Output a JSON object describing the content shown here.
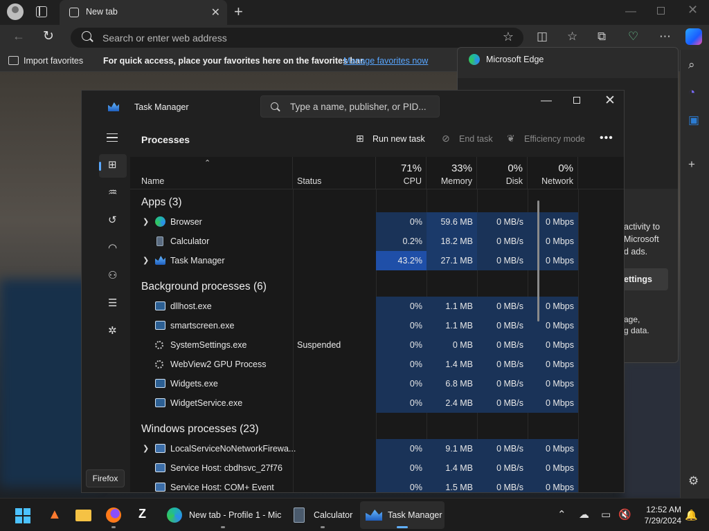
{
  "browser": {
    "tab_title": "New tab",
    "address_placeholder": "Search or enter web address",
    "favbar": {
      "import_label": "Import favorites",
      "message": "For quick access, place your favorites here on the favorites bar.",
      "manage_link": "Manage favorites now"
    },
    "panel": {
      "title": "Microsoft Edge",
      "text_lines": [
        "activity to",
        "Microsoft",
        "d ads."
      ],
      "button_label": "ettings",
      "text_lines2": [
        "age,",
        "g data."
      ]
    }
  },
  "task_manager": {
    "title": "Task Manager",
    "search_placeholder": "Type a name, publisher, or PID...",
    "page_title": "Processes",
    "commands": {
      "run_new_task": "Run new task",
      "end_task": "End task",
      "efficiency_mode": "Efficiency mode"
    },
    "columns": {
      "name": "Name",
      "status": "Status",
      "cpu_pct": "71%",
      "cpu": "CPU",
      "memory_pct": "33%",
      "memory": "Memory",
      "disk_pct": "0%",
      "disk": "Disk",
      "network_pct": "0%",
      "network": "Network"
    },
    "groups": {
      "apps": "Apps (3)",
      "background": "Background processes (6)",
      "windows": "Windows processes (23)"
    },
    "processes": [
      {
        "name": "Browser",
        "status": "",
        "cpu": "0%",
        "memory": "59.6 MB",
        "disk": "0 MB/s",
        "network": "0 Mbps"
      },
      {
        "name": "Calculator",
        "status": "",
        "cpu": "0.2%",
        "memory": "18.2 MB",
        "disk": "0 MB/s",
        "network": "0 Mbps"
      },
      {
        "name": "Task Manager",
        "status": "",
        "cpu": "43.2%",
        "memory": "27.1 MB",
        "disk": "0 MB/s",
        "network": "0 Mbps"
      },
      {
        "name": "dllhost.exe",
        "status": "",
        "cpu": "0%",
        "memory": "1.1 MB",
        "disk": "0 MB/s",
        "network": "0 Mbps"
      },
      {
        "name": "smartscreen.exe",
        "status": "",
        "cpu": "0%",
        "memory": "1.1 MB",
        "disk": "0 MB/s",
        "network": "0 Mbps"
      },
      {
        "name": "SystemSettings.exe",
        "status": "Suspended",
        "cpu": "0%",
        "memory": "0 MB",
        "disk": "0 MB/s",
        "network": "0 Mbps"
      },
      {
        "name": "WebView2 GPU Process",
        "status": "",
        "cpu": "0%",
        "memory": "1.4 MB",
        "disk": "0 MB/s",
        "network": "0 Mbps"
      },
      {
        "name": "Widgets.exe",
        "status": "",
        "cpu": "0%",
        "memory": "6.8 MB",
        "disk": "0 MB/s",
        "network": "0 Mbps"
      },
      {
        "name": "WidgetService.exe",
        "status": "",
        "cpu": "0%",
        "memory": "2.4 MB",
        "disk": "0 MB/s",
        "network": "0 Mbps"
      },
      {
        "name": "LocalServiceNoNetworkFirewa...",
        "status": "",
        "cpu": "0%",
        "memory": "9.1 MB",
        "disk": "0 MB/s",
        "network": "0 Mbps"
      },
      {
        "name": "Service Host: cbdhsvc_27f76",
        "status": "",
        "cpu": "0%",
        "memory": "1.4 MB",
        "disk": "0 MB/s",
        "network": "0 Mbps"
      },
      {
        "name": "Service Host: COM+ Event Sys...",
        "status": "",
        "cpu": "0%",
        "memory": "1.5 MB",
        "disk": "0 MB/s",
        "network": "0 Mbps"
      }
    ]
  },
  "tooltip": "Firefox",
  "taskbar": {
    "edge_label": "New tab - Profile 1 - Mic",
    "calculator_label": "Calculator",
    "taskmanager_label": "Task Manager",
    "clock_time": "12:52 AM",
    "clock_date": "7/29/2024"
  },
  "colors": {
    "accent": "#60b0ff",
    "heat_low": "#1a3358",
    "heat_mid": "#1b3a6a",
    "heat_high": "#1f4fa8",
    "link": "#58a6ff"
  }
}
